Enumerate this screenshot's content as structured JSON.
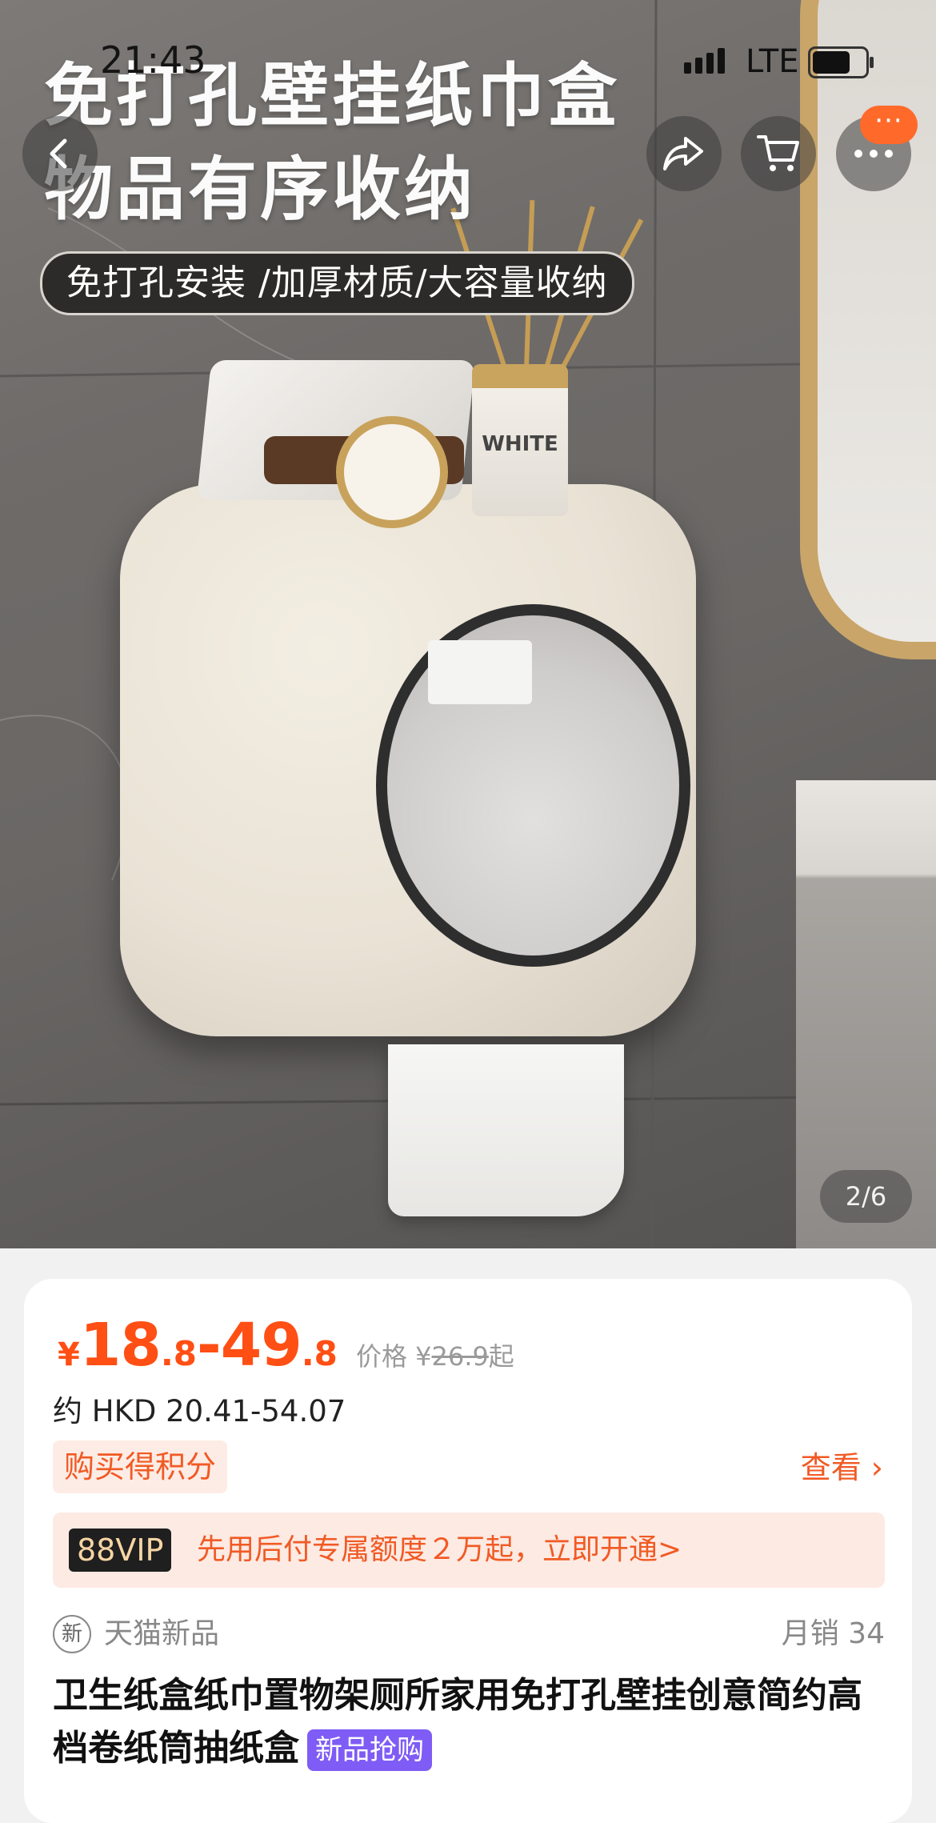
{
  "status_bar": {
    "time": "21:43",
    "network": "LTE"
  },
  "hero": {
    "headline_line1": "免打孔壁挂纸巾盒",
    "headline_line2": "物品有序收纳",
    "feature_banner": "免打孔安装 /加厚材质/大容量收纳",
    "bottle_label": "WHITE",
    "image_counter": "2/6"
  },
  "nav": {
    "back_icon": "chevron-left-icon",
    "share_icon": "share-icon",
    "cart_icon": "cart-icon",
    "more_icon": "more-dots-icon",
    "more_badge": "···"
  },
  "price": {
    "currency": "¥",
    "low_int": "18",
    "low_dec": ".8",
    "separator": "-",
    "high_int": "49",
    "high_dec": ".8",
    "orig_label": "价格 ¥",
    "orig_value": "26.9",
    "orig_suffix": "起",
    "hkd": "约 HKD 20.41-54.07"
  },
  "points": {
    "label": "购买得积分",
    "view": "查看 ›"
  },
  "vip": {
    "badge": "88VIP",
    "text": "先用后付专属额度２万起，立即开通>"
  },
  "brand": {
    "icon_text": "新",
    "name": "天猫新品",
    "monthly_sales": "月销 34"
  },
  "product": {
    "title": "卫生纸盒纸巾置物架厕所家用免打孔壁挂创意简约高档卷纸筒抽纸盒",
    "new_tag": "新品抢购"
  },
  "colors": {
    "accent": "#ff4f14",
    "vip_badge_bg": "#1f1f1f",
    "new_tag_bg": "#7f5cf5"
  }
}
